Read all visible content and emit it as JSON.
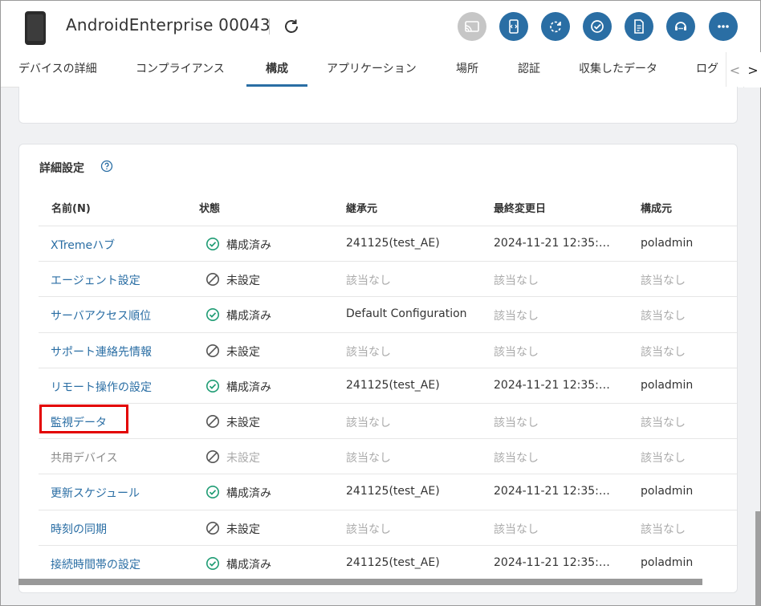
{
  "header": {
    "device_title": "AndroidEnterprise 00043",
    "icons": [
      "device-phone-icon",
      "refresh-icon",
      "cast-icon",
      "remote-control-icon",
      "sync-icon",
      "check-icon",
      "document-icon",
      "support-icon",
      "more-icon"
    ],
    "accent_color": "#2a6ea4"
  },
  "tabs": [
    {
      "label": "デバイスの詳細"
    },
    {
      "label": "コンプライアンス"
    },
    {
      "label": "構成",
      "active": true
    },
    {
      "label": "アプリケーション"
    },
    {
      "label": "場所"
    },
    {
      "label": "認証"
    },
    {
      "label": "収集したデータ"
    },
    {
      "label": "ログ"
    }
  ],
  "tab_nav": {
    "prev": "<",
    "next": ">"
  },
  "section": {
    "title": "詳細設定"
  },
  "table": {
    "headers": [
      "名前(N)",
      "状態",
      "継承元",
      "最終変更日",
      "構成元"
    ],
    "rows": [
      {
        "name": "XTremeハブ",
        "status": "構成済み",
        "configured": true,
        "inherit": "241125(test_AE)",
        "modified": "2024-11-21 12:35:…",
        "source": "poladmin"
      },
      {
        "name": "エージェント設定",
        "status": "未設定",
        "configured": false,
        "inherit": "該当なし",
        "modified": "該当なし",
        "source": "該当なし"
      },
      {
        "name": "サーバアクセス順位",
        "status": "構成済み",
        "configured": true,
        "inherit": "Default Configuration",
        "modified": "該当なし",
        "source": "該当なし"
      },
      {
        "name": "サポート連絡先情報",
        "status": "未設定",
        "configured": false,
        "inherit": "該当なし",
        "modified": "該当なし",
        "source": "該当なし"
      },
      {
        "name": "リモート操作の設定",
        "status": "構成済み",
        "configured": true,
        "inherit": "241125(test_AE)",
        "modified": "2024-11-21 12:35:…",
        "source": "poladmin"
      },
      {
        "name": "監視データ",
        "status": "未設定",
        "configured": false,
        "inherit": "該当なし",
        "modified": "該当なし",
        "source": "該当なし"
      },
      {
        "name": "共用デバイス",
        "status": "未設定",
        "configured": false,
        "disabled": true,
        "inherit": "該当なし",
        "modified": "該当なし",
        "source": "該当なし"
      },
      {
        "name": "更新スケジュール",
        "status": "構成済み",
        "configured": true,
        "inherit": "241125(test_AE)",
        "modified": "2024-11-21 12:35:…",
        "source": "poladmin"
      },
      {
        "name": "時刻の同期",
        "status": "未設定",
        "configured": false,
        "inherit": "該当なし",
        "modified": "該当なし",
        "source": "該当なし"
      },
      {
        "name": "接続時間帯の設定",
        "status": "構成済み",
        "configured": true,
        "inherit": "241125(test_AE)",
        "modified": "2024-11-21 12:35:…",
        "source": "poladmin"
      }
    ]
  }
}
